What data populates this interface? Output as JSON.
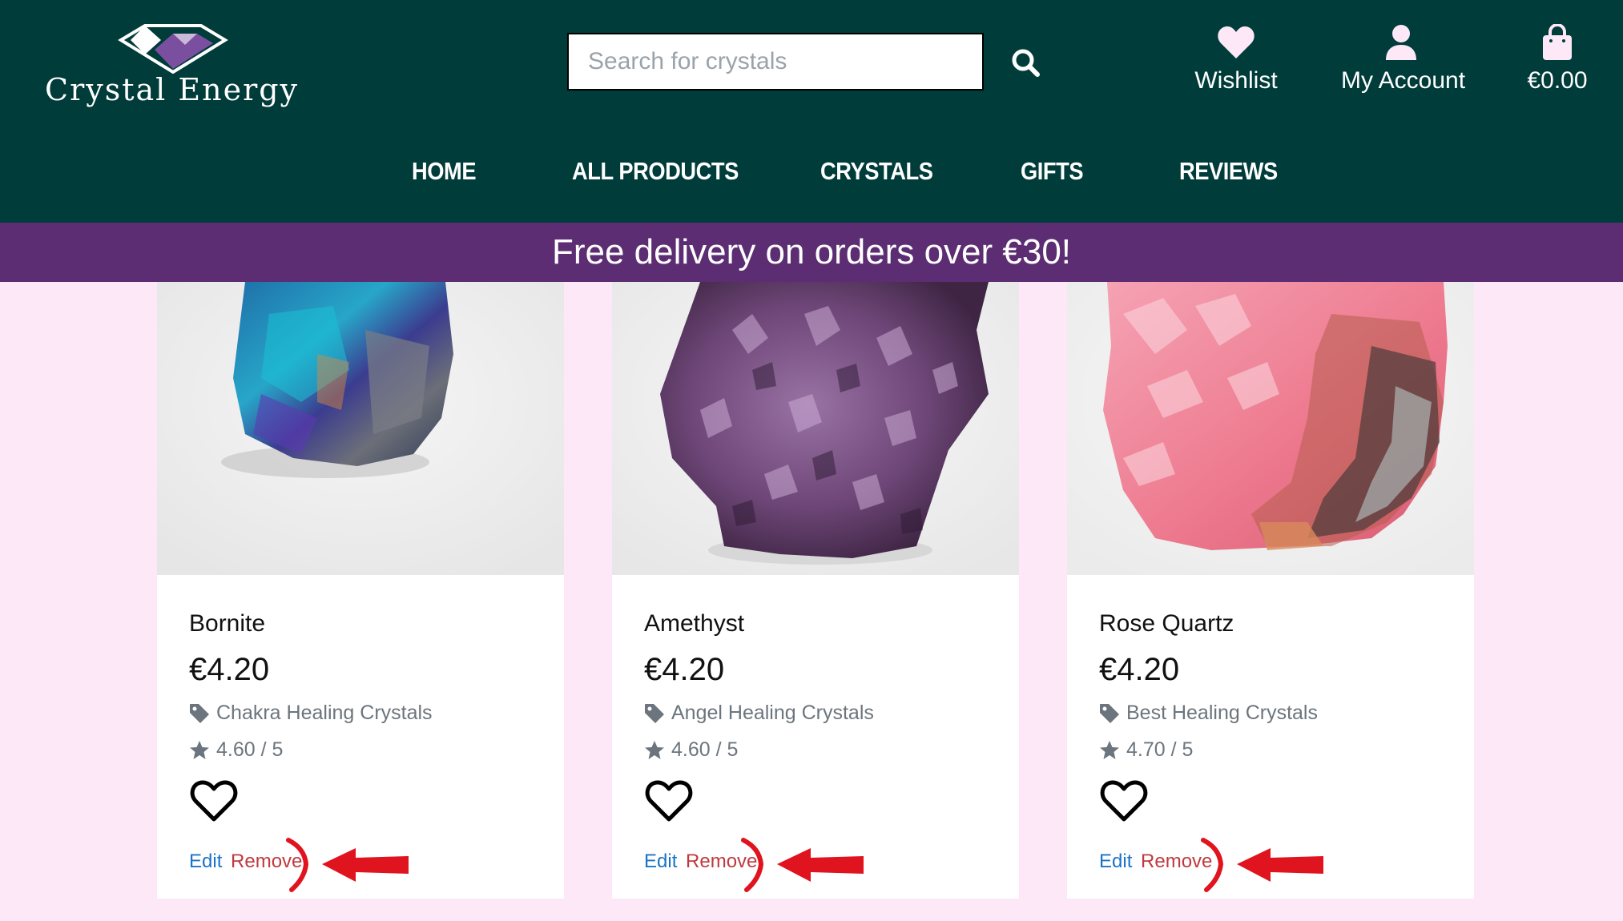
{
  "header": {
    "logo_text": "Crystal Energy",
    "search_placeholder": "Search for crystals",
    "wishlist_label": "Wishlist",
    "account_label": "My Account",
    "cart_total": "€0.00"
  },
  "nav": {
    "items": [
      {
        "label": "HOME"
      },
      {
        "label": "ALL PRODUCTS"
      },
      {
        "label": "CRYSTALS"
      },
      {
        "label": "GIFTS"
      },
      {
        "label": "REVIEWS"
      }
    ]
  },
  "banner": {
    "text": "Free delivery on orders over €30!"
  },
  "products": [
    {
      "name": "Bornite",
      "price": "€4.20",
      "category": "Chakra Healing Crystals",
      "rating": "4.60 / 5",
      "edit_label": "Edit",
      "remove_label": "Remove",
      "image": "bornite-crystal-photo"
    },
    {
      "name": "Amethyst",
      "price": "€4.20",
      "category": "Angel Healing Crystals",
      "rating": "4.60 / 5",
      "edit_label": "Edit",
      "remove_label": "Remove",
      "image": "amethyst-crystal-photo"
    },
    {
      "name": "Rose Quartz",
      "price": "€4.20",
      "category": "Best Healing Crystals",
      "rating": "4.70 / 5",
      "edit_label": "Edit",
      "remove_label": "Remove",
      "image": "rose-quartz-crystal-photo"
    }
  ],
  "icons": {
    "search": "search-icon",
    "wishlist": "heart-icon",
    "account": "user-icon",
    "cart": "shopping-bag-icon",
    "category": "tag-icon",
    "rating": "star-icon",
    "card_wishlist": "heart-outline-icon"
  },
  "colors": {
    "header_bg": "#003c3a",
    "banner_bg": "#5c2d72",
    "page_bg": "#fde8f7",
    "wishlist_icon": "#fde8f7",
    "edit_link": "#1a73c8",
    "remove_link": "#c0393f",
    "annotation": "#e0141e"
  }
}
